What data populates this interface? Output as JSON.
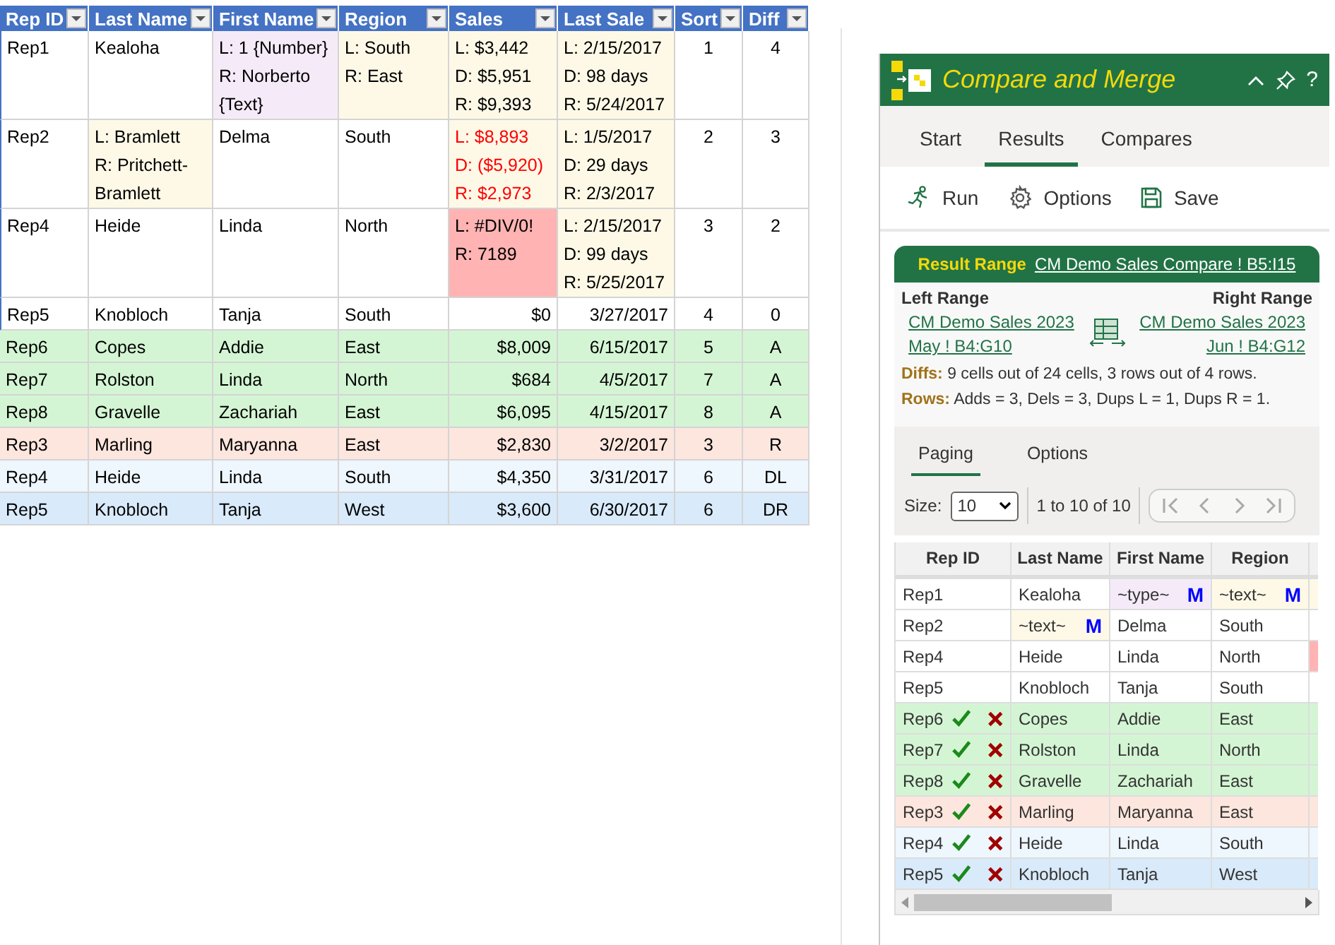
{
  "sheet": {
    "columns": [
      {
        "label": "Rep ID",
        "kind": "text"
      },
      {
        "label": "Last Name",
        "kind": "text"
      },
      {
        "label": "First Name",
        "kind": "text"
      },
      {
        "label": "Region",
        "kind": "text"
      },
      {
        "label": "Sales",
        "kind": "number"
      },
      {
        "label": "Last Sale",
        "kind": "number"
      },
      {
        "label": "Sort",
        "kind": "index"
      },
      {
        "label": "Diff",
        "kind": "index"
      }
    ],
    "rows": [
      {
        "kind": "changed",
        "cells": [
          {
            "lines": [
              "Rep1"
            ],
            "kind": "plain"
          },
          {
            "lines": [
              "Kealoha"
            ],
            "kind": "plain"
          },
          {
            "lines": [
              "L: 1 {Number}",
              "R: Norberto",
              "{Text}"
            ],
            "kind": "type"
          },
          {
            "lines": [
              "L: South",
              "R: East"
            ],
            "kind": "changed"
          },
          {
            "lines": [
              "L: $3,442",
              "D: $5,951",
              "R: $9,393"
            ],
            "kind": "changed"
          },
          {
            "lines": [
              "L: 2/15/2017",
              "D: 98 days",
              "R: 5/24/2017"
            ],
            "kind": "changed"
          },
          {
            "lines": [
              "1"
            ],
            "kind": "plain"
          },
          {
            "lines": [
              "4"
            ],
            "kind": "plain"
          }
        ]
      },
      {
        "kind": "changed",
        "cells": [
          {
            "lines": [
              "Rep2"
            ],
            "kind": "plain"
          },
          {
            "lines": [
              "L: Bramlett",
              "R: Pritchett-",
              "Bramlett"
            ],
            "kind": "changed"
          },
          {
            "lines": [
              "Delma"
            ],
            "kind": "plain"
          },
          {
            "lines": [
              "South"
            ],
            "kind": "plain"
          },
          {
            "lines": [
              "L: $8,893",
              "D: ($5,920)",
              "R: $2,973"
            ],
            "kind": "negative"
          },
          {
            "lines": [
              "L: 1/5/2017",
              "D: 29 days",
              "R: 2/3/2017"
            ],
            "kind": "changed"
          },
          {
            "lines": [
              "2"
            ],
            "kind": "plain"
          },
          {
            "lines": [
              "3"
            ],
            "kind": "plain"
          }
        ]
      },
      {
        "kind": "changed",
        "cells": [
          {
            "lines": [
              "Rep4"
            ],
            "kind": "plain"
          },
          {
            "lines": [
              "Heide"
            ],
            "kind": "plain"
          },
          {
            "lines": [
              "Linda"
            ],
            "kind": "plain"
          },
          {
            "lines": [
              "North"
            ],
            "kind": "plain"
          },
          {
            "lines": [
              "L: #DIV/0!",
              "R: 7189"
            ],
            "kind": "error"
          },
          {
            "lines": [
              "L: 2/15/2017",
              "D: 99 days",
              "R: 5/25/2017"
            ],
            "kind": "changed"
          },
          {
            "lines": [
              "3"
            ],
            "kind": "plain"
          },
          {
            "lines": [
              "2"
            ],
            "kind": "plain"
          }
        ]
      },
      {
        "kind": "same",
        "cells": [
          {
            "lines": [
              "Rep5"
            ],
            "kind": "plain"
          },
          {
            "lines": [
              "Knobloch"
            ],
            "kind": "plain"
          },
          {
            "lines": [
              "Tanja"
            ],
            "kind": "plain"
          },
          {
            "lines": [
              "South"
            ],
            "kind": "plain"
          },
          {
            "lines": [
              "$0"
            ],
            "kind": "plain"
          },
          {
            "lines": [
              "3/27/2017"
            ],
            "kind": "plain"
          },
          {
            "lines": [
              "4"
            ],
            "kind": "plain"
          },
          {
            "lines": [
              "0"
            ],
            "kind": "plain"
          }
        ]
      },
      {
        "kind": "added",
        "cells": [
          {
            "lines": [
              "Rep6"
            ],
            "kind": "plain"
          },
          {
            "lines": [
              "Copes"
            ],
            "kind": "plain"
          },
          {
            "lines": [
              "Addie"
            ],
            "kind": "plain"
          },
          {
            "lines": [
              "East"
            ],
            "kind": "plain"
          },
          {
            "lines": [
              "$8,009"
            ],
            "kind": "plain"
          },
          {
            "lines": [
              "6/15/2017"
            ],
            "kind": "plain"
          },
          {
            "lines": [
              "5"
            ],
            "kind": "plain"
          },
          {
            "lines": [
              "A"
            ],
            "kind": "plain"
          }
        ]
      },
      {
        "kind": "added",
        "cells": [
          {
            "lines": [
              "Rep7"
            ],
            "kind": "plain"
          },
          {
            "lines": [
              "Rolston"
            ],
            "kind": "plain"
          },
          {
            "lines": [
              "Linda"
            ],
            "kind": "plain"
          },
          {
            "lines": [
              "North"
            ],
            "kind": "plain"
          },
          {
            "lines": [
              "$684"
            ],
            "kind": "plain"
          },
          {
            "lines": [
              "4/5/2017"
            ],
            "kind": "plain"
          },
          {
            "lines": [
              "7"
            ],
            "kind": "plain"
          },
          {
            "lines": [
              "A"
            ],
            "kind": "plain"
          }
        ]
      },
      {
        "kind": "added",
        "cells": [
          {
            "lines": [
              "Rep8"
            ],
            "kind": "plain"
          },
          {
            "lines": [
              "Gravelle"
            ],
            "kind": "plain"
          },
          {
            "lines": [
              "Zachariah"
            ],
            "kind": "plain"
          },
          {
            "lines": [
              "East"
            ],
            "kind": "plain"
          },
          {
            "lines": [
              "$6,095"
            ],
            "kind": "plain"
          },
          {
            "lines": [
              "4/15/2017"
            ],
            "kind": "plain"
          },
          {
            "lines": [
              "8"
            ],
            "kind": "plain"
          },
          {
            "lines": [
              "A"
            ],
            "kind": "plain"
          }
        ]
      },
      {
        "kind": "removed",
        "cells": [
          {
            "lines": [
              "Rep3"
            ],
            "kind": "plain"
          },
          {
            "lines": [
              "Marling"
            ],
            "kind": "plain"
          },
          {
            "lines": [
              "Maryanna"
            ],
            "kind": "plain"
          },
          {
            "lines": [
              "East"
            ],
            "kind": "plain"
          },
          {
            "lines": [
              "$2,830"
            ],
            "kind": "plain"
          },
          {
            "lines": [
              "3/2/2017"
            ],
            "kind": "plain"
          },
          {
            "lines": [
              "3"
            ],
            "kind": "plain"
          },
          {
            "lines": [
              "R"
            ],
            "kind": "plain"
          }
        ]
      },
      {
        "kind": "dup_left",
        "cells": [
          {
            "lines": [
              "Rep4"
            ],
            "kind": "plain"
          },
          {
            "lines": [
              "Heide"
            ],
            "kind": "plain"
          },
          {
            "lines": [
              "Linda"
            ],
            "kind": "plain"
          },
          {
            "lines": [
              "South"
            ],
            "kind": "plain"
          },
          {
            "lines": [
              "$4,350"
            ],
            "kind": "plain"
          },
          {
            "lines": [
              "3/31/2017"
            ],
            "kind": "plain"
          },
          {
            "lines": [
              "6"
            ],
            "kind": "plain"
          },
          {
            "lines": [
              "DL"
            ],
            "kind": "plain"
          }
        ]
      },
      {
        "kind": "dup_right",
        "cells": [
          {
            "lines": [
              "Rep5"
            ],
            "kind": "plain"
          },
          {
            "lines": [
              "Knobloch"
            ],
            "kind": "plain"
          },
          {
            "lines": [
              "Tanja"
            ],
            "kind": "plain"
          },
          {
            "lines": [
              "West"
            ],
            "kind": "plain"
          },
          {
            "lines": [
              "$3,600"
            ],
            "kind": "plain"
          },
          {
            "lines": [
              "6/30/2017"
            ],
            "kind": "plain"
          },
          {
            "lines": [
              "6"
            ],
            "kind": "plain"
          },
          {
            "lines": [
              "DR"
            ],
            "kind": "plain"
          }
        ]
      }
    ]
  },
  "panel": {
    "title": "Compare and Merge",
    "help": "?",
    "tabs": [
      {
        "label": "Start",
        "selected": false
      },
      {
        "label": "Results",
        "selected": true
      },
      {
        "label": "Compares",
        "selected": false
      }
    ],
    "toolbar": [
      {
        "kind": "run",
        "label": "Run"
      },
      {
        "kind": "options",
        "label": "Options"
      },
      {
        "kind": "save",
        "label": "Save"
      }
    ],
    "result": {
      "label": "Result Range",
      "link": "CM Demo Sales Compare ! B5:I15",
      "left_label": "Left Range",
      "left_link": [
        "CM Demo Sales 2023",
        "May ! B4:G10"
      ],
      "right_label": "Right Range",
      "right_link": [
        "CM Demo Sales 2023",
        "Jun ! B4:G12"
      ],
      "diffs_label": "Diffs:",
      "diffs": "9 cells out of 24 cells, 3 rows out of 4 rows.",
      "rows_label": "Rows:",
      "rows": "Adds = 3, Dels = 3, Dups L = 1, Dups R = 1."
    },
    "subtabs": [
      {
        "label": "Paging",
        "selected": true
      },
      {
        "label": "Options",
        "selected": false
      }
    ],
    "paging": {
      "size_label": "Size:",
      "size": "10",
      "range": "1 to 10 of 10",
      "disabled": true
    },
    "grid": {
      "columns": [
        "Rep ID",
        "Last Name",
        "First Name",
        "Region"
      ],
      "rows": [
        {
          "kind": "changed",
          "actions": false,
          "cut_cell": {
            "kind": "changed"
          },
          "cells": [
            {
              "text": "Rep1",
              "kind": "plain"
            },
            {
              "text": "Kealoha",
              "kind": "plain"
            },
            {
              "text": "~type~",
              "kind": "type",
              "marker": "M"
            },
            {
              "text": "~text~",
              "kind": "changed",
              "marker": "M"
            }
          ]
        },
        {
          "kind": "changed",
          "actions": false,
          "cut_cell": {
            "kind": "plain"
          },
          "cells": [
            {
              "text": "Rep2",
              "kind": "plain"
            },
            {
              "text": "~text~",
              "kind": "changed",
              "marker": "M"
            },
            {
              "text": "Delma",
              "kind": "plain"
            },
            {
              "text": "South",
              "kind": "plain"
            }
          ]
        },
        {
          "kind": "changed",
          "actions": false,
          "cut_cell": {
            "kind": "error"
          },
          "cells": [
            {
              "text": "Rep4",
              "kind": "plain"
            },
            {
              "text": "Heide",
              "kind": "plain"
            },
            {
              "text": "Linda",
              "kind": "plain"
            },
            {
              "text": "North",
              "kind": "plain"
            }
          ]
        },
        {
          "kind": "same",
          "actions": false,
          "cut_cell": {
            "kind": "plain"
          },
          "cells": [
            {
              "text": "Rep5",
              "kind": "plain"
            },
            {
              "text": "Knobloch",
              "kind": "plain"
            },
            {
              "text": "Tanja",
              "kind": "plain"
            },
            {
              "text": "South",
              "kind": "plain"
            }
          ]
        },
        {
          "kind": "added",
          "actions": true,
          "cells": [
            {
              "text": "Rep6",
              "kind": "plain"
            },
            {
              "text": "Copes",
              "kind": "plain"
            },
            {
              "text": "Addie",
              "kind": "plain"
            },
            {
              "text": "East",
              "kind": "plain"
            }
          ]
        },
        {
          "kind": "added",
          "actions": true,
          "cells": [
            {
              "text": "Rep7",
              "kind": "plain"
            },
            {
              "text": "Rolston",
              "kind": "plain"
            },
            {
              "text": "Linda",
              "kind": "plain"
            },
            {
              "text": "North",
              "kind": "plain"
            }
          ]
        },
        {
          "kind": "added",
          "actions": true,
          "cells": [
            {
              "text": "Rep8",
              "kind": "plain"
            },
            {
              "text": "Gravelle",
              "kind": "plain"
            },
            {
              "text": "Zachariah",
              "kind": "plain"
            },
            {
              "text": "East",
              "kind": "plain"
            }
          ]
        },
        {
          "kind": "removed",
          "actions": true,
          "cells": [
            {
              "text": "Rep3",
              "kind": "plain"
            },
            {
              "text": "Marling",
              "kind": "plain"
            },
            {
              "text": "Maryanna",
              "kind": "plain"
            },
            {
              "text": "East",
              "kind": "plain"
            }
          ]
        },
        {
          "kind": "dup_left",
          "actions": true,
          "cells": [
            {
              "text": "Rep4",
              "kind": "plain"
            },
            {
              "text": "Heide",
              "kind": "plain"
            },
            {
              "text": "Linda",
              "kind": "plain"
            },
            {
              "text": "South",
              "kind": "plain"
            }
          ]
        },
        {
          "kind": "dup_right",
          "actions": true,
          "cells": [
            {
              "text": "Rep5",
              "kind": "plain"
            },
            {
              "text": "Knobloch",
              "kind": "plain"
            },
            {
              "text": "Tanja",
              "kind": "plain"
            },
            {
              "text": "West",
              "kind": "plain"
            }
          ]
        }
      ]
    }
  }
}
